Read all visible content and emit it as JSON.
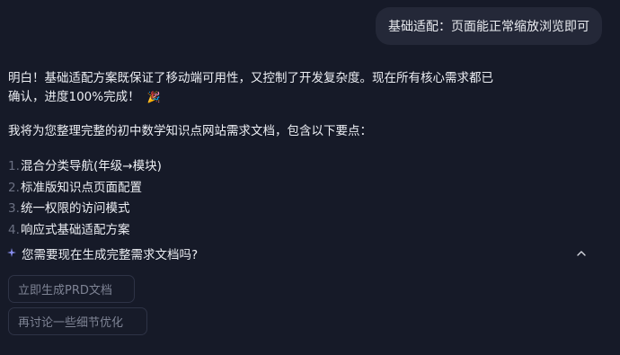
{
  "user_message": {
    "text": "基础适配：页面能正常缩放浏览即可"
  },
  "assistant": {
    "intro_line1": "明白！基础适配方案既保证了移动端可用性，又控制了开发复杂度。现在所有核心需求都已",
    "intro_line2": "确认，进度100%完成！",
    "intro_emoji": "🎉",
    "summary": "我将为您整理完整的初中数学知识点网站需求文档，包含以下要点：",
    "points": [
      {
        "num": "1.",
        "text": "混合分类导航(年级→模块)"
      },
      {
        "num": "2.",
        "text": "标准版知识点页面配置"
      },
      {
        "num": "3.",
        "text": "统一权限的访问模式"
      },
      {
        "num": "4.",
        "text": "响应式基础适配方案"
      }
    ]
  },
  "followup": {
    "question": "您需要现在生成完整需求文档吗?",
    "sparkle_icon": "sparkle-icon",
    "collapse_icon": "chevron-up-icon"
  },
  "suggestions": [
    {
      "label": "立即生成PRD文档"
    },
    {
      "label": "再讨论一些细节优化"
    }
  ],
  "colors": {
    "background": "#161a28",
    "bubble": "#242838",
    "text": "#eceef3",
    "muted": "#7e8394",
    "accent": "#8a8ff0"
  }
}
